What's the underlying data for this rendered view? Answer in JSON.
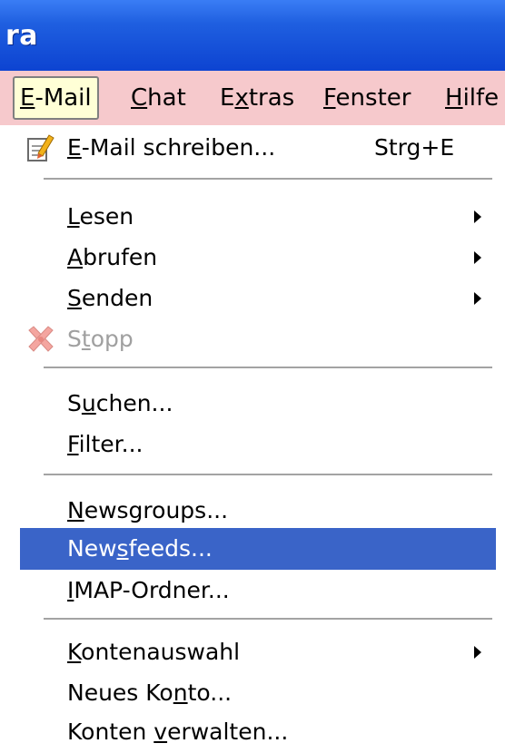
{
  "window": {
    "title_fragment": "ra"
  },
  "menubar": {
    "items": [
      {
        "label": "E-Mail",
        "mnemonic_index": 0
      },
      {
        "label": "Chat",
        "mnemonic_index": 0
      },
      {
        "label": "Extras",
        "mnemonic_index": 1
      },
      {
        "label": "Fenster",
        "mnemonic_index": 0
      },
      {
        "label": "Hilfe",
        "mnemonic_index": 0
      }
    ]
  },
  "dropdown": {
    "items": [
      {
        "label": "E-Mail schreiben...",
        "shortcut": "Strg+E",
        "mnemonic_index": 0,
        "icon": "compose-icon"
      },
      {
        "label": "Lesen",
        "mnemonic_index": 0,
        "submenu": true
      },
      {
        "label": "Abrufen",
        "mnemonic_index": 0,
        "submenu": true
      },
      {
        "label": "Senden",
        "mnemonic_index": 0,
        "submenu": true
      },
      {
        "label": "Stopp",
        "mnemonic_index": 1,
        "disabled": true,
        "icon": "stop-icon"
      },
      {
        "label": "Suchen...",
        "mnemonic_index": 1
      },
      {
        "label": "Filter...",
        "mnemonic_index": 0
      },
      {
        "label": "Newsgroups...",
        "mnemonic_index": 0
      },
      {
        "label": "Newsfeeds...",
        "mnemonic_index": 3,
        "highlighted": true
      },
      {
        "label": "IMAP-Ordner...",
        "mnemonic_index": 0
      },
      {
        "label": "Kontenauswahl",
        "mnemonic_index": 0,
        "submenu": true
      },
      {
        "label": "Neues Konto...",
        "mnemonic_index": 8
      },
      {
        "label": "Konten verwalten...",
        "mnemonic_index": 7
      }
    ]
  },
  "colors": {
    "titlebar": "#0a3fcf",
    "menubar_bg": "#f6c9cc",
    "highlight": "#3a64c8",
    "disabled_text": "#a0a0a0"
  }
}
